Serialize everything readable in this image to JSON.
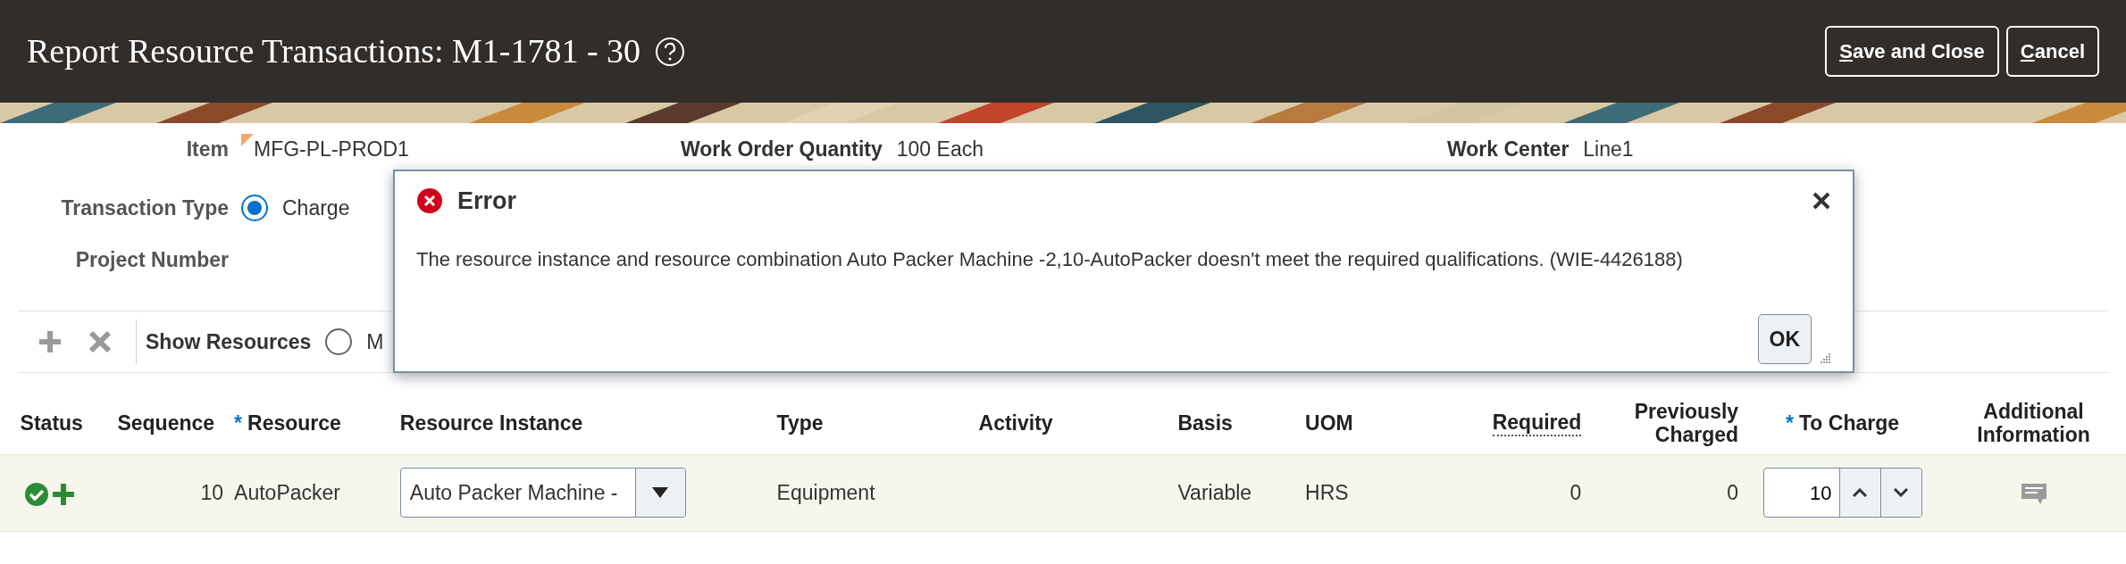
{
  "header": {
    "title": "Report Resource Transactions: M1-1781 - 30",
    "buttons": [
      {
        "label": "Save and Close",
        "access_key_underlined": true
      },
      {
        "label": "Cancel",
        "access_key_underlined": true
      }
    ]
  },
  "form": {
    "item": {
      "label": "Item",
      "value": "MFG-PL-PROD1"
    },
    "work_order_quantity": {
      "label": "Work Order Quantity",
      "value": "100 Each"
    },
    "work_center": {
      "label": "Work Center",
      "value": "Line1"
    },
    "transaction_type": {
      "label": "Transaction Type",
      "options": [
        {
          "label": "Charge",
          "selected": true
        }
      ]
    },
    "project_number": {
      "label": "Project Number"
    }
  },
  "toolbar": {
    "buttons": [
      {
        "kind": "add",
        "disabled": true
      },
      {
        "kind": "delete",
        "disabled": true
      }
    ],
    "show_resources": {
      "label": "Show Resources",
      "options": [
        {
          "label": "M",
          "selected": false
        }
      ]
    }
  },
  "table": {
    "columns": [
      {
        "label": "Status"
      },
      {
        "label": "Sequence"
      },
      {
        "label": "Resource",
        "required_mark": "*"
      },
      {
        "label": "Resource Instance"
      },
      {
        "label": "Type"
      },
      {
        "label": "Activity"
      },
      {
        "label": "Basis"
      },
      {
        "label": "UOM"
      },
      {
        "label": "Required",
        "has_help": true
      },
      {
        "label": "Previously Charged"
      },
      {
        "label": "To Charge",
        "required_mark": "*"
      },
      {
        "label": "Additional Information"
      }
    ],
    "rows": [
      {
        "selected": true,
        "sequence": "10",
        "resource": "AutoPacker",
        "resource_instance": "Auto Packer Machine -",
        "type": "Equipment",
        "basis": "Variable",
        "uom": "HRS",
        "required": "0",
        "previously_charged": "0",
        "to_charge": "10"
      }
    ]
  },
  "dialog": {
    "title": "Error",
    "message": "The resource instance and resource combination Auto Packer Machine -2,10-AutoPacker doesn't meet the required qualifications. (WIE-4426188)",
    "button": "OK"
  }
}
